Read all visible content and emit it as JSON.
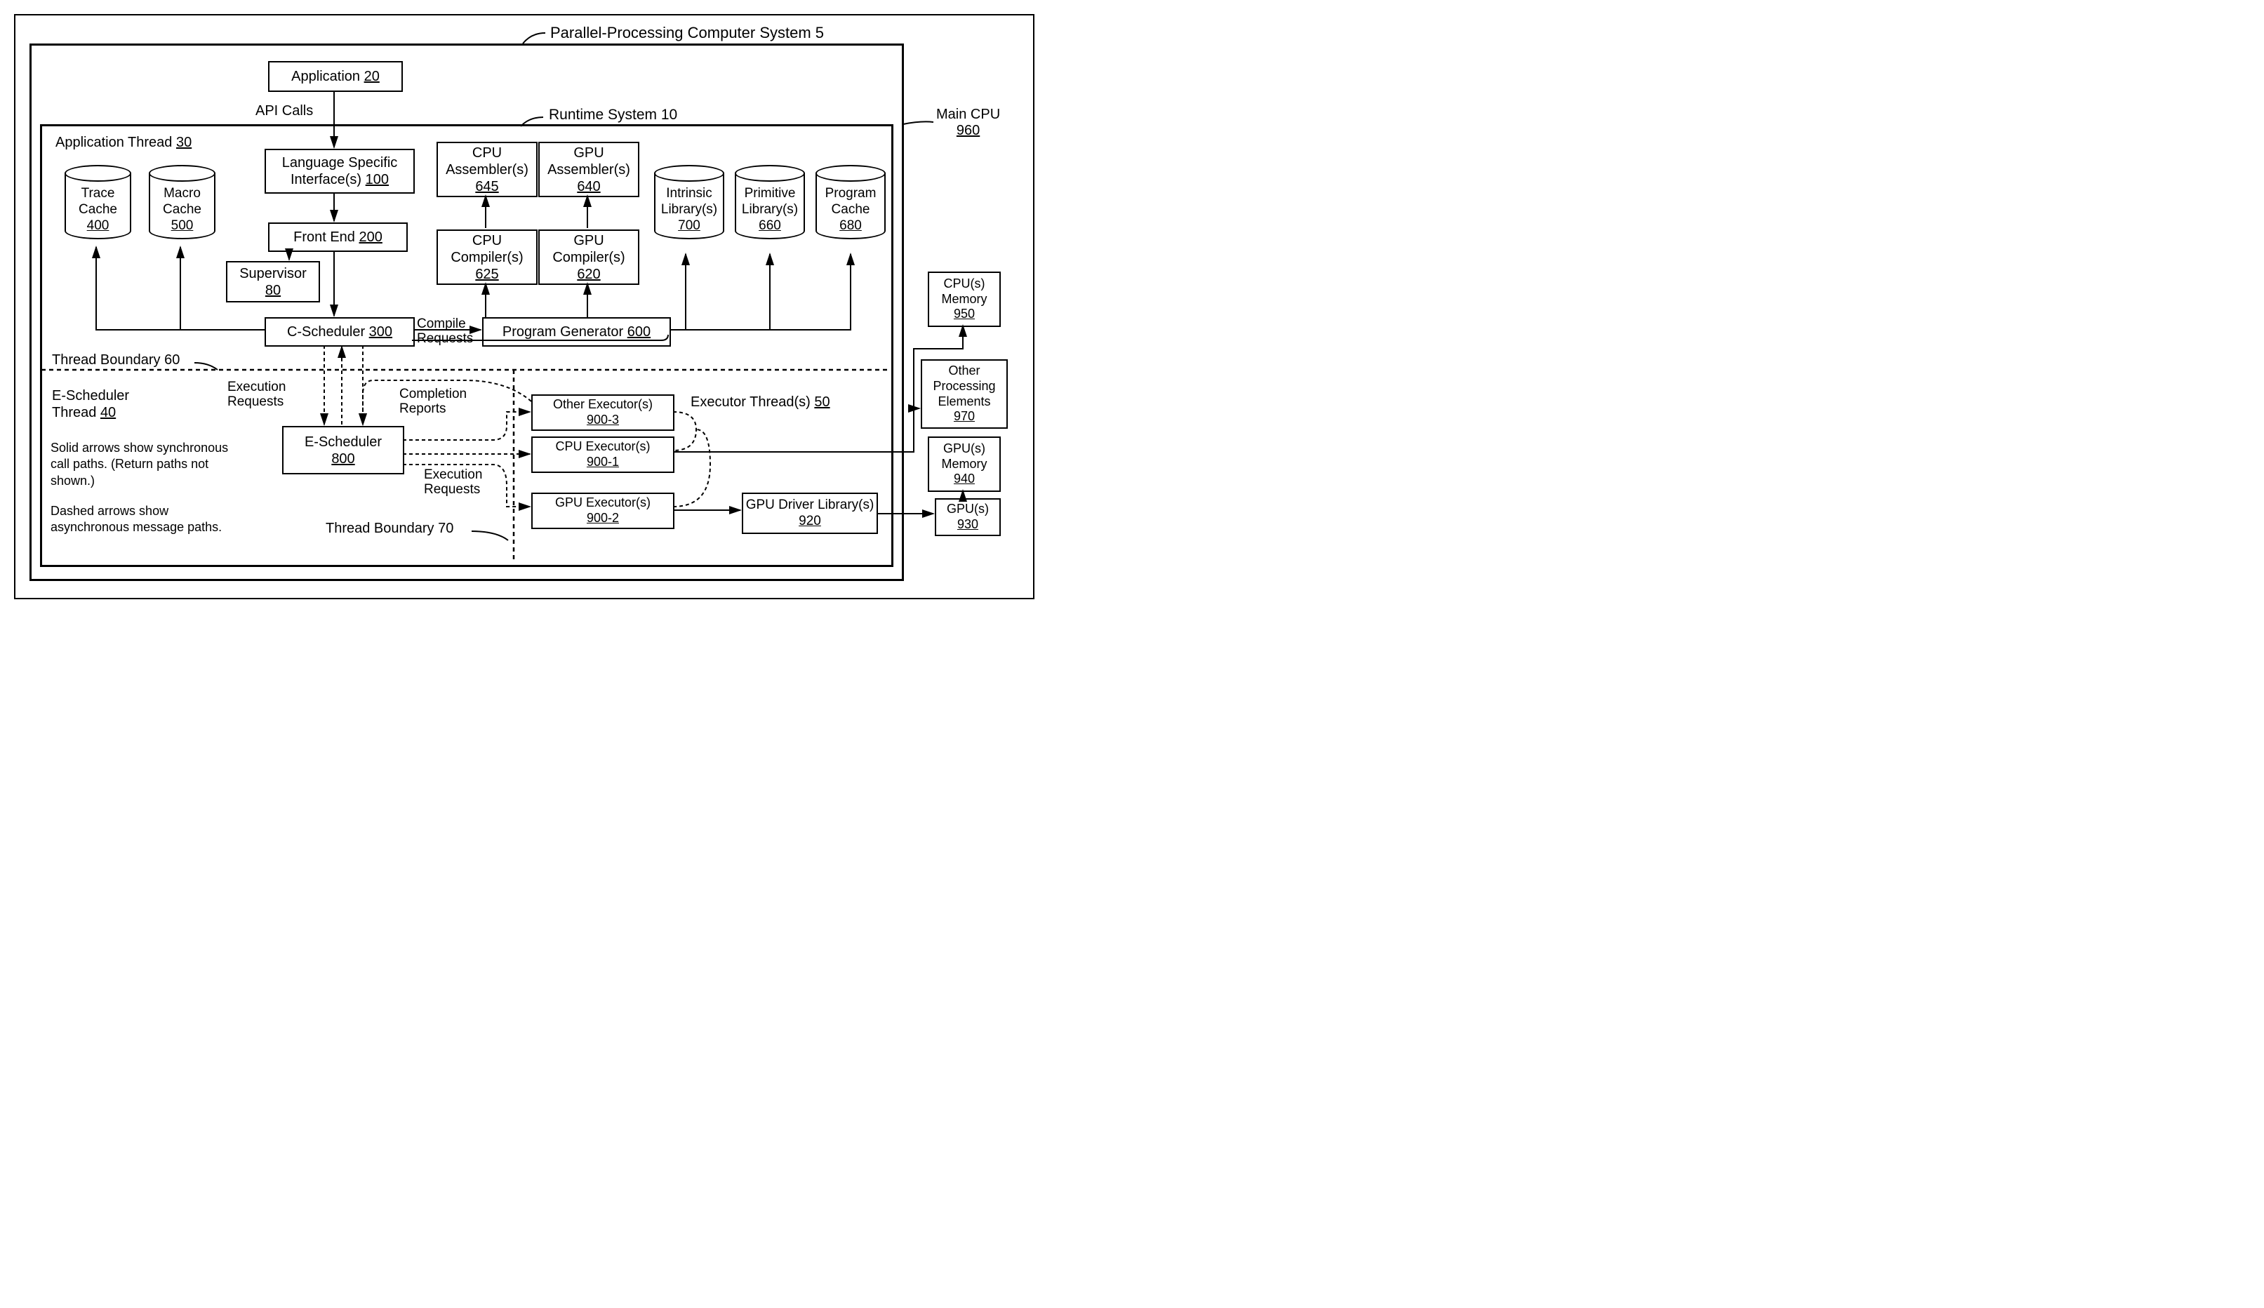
{
  "title": "Parallel-Processing Computer System 5",
  "main_cpu": {
    "label": "Main CPU",
    "num": "960"
  },
  "runtime": {
    "label": "Runtime System 10"
  },
  "app_thread": {
    "label": "Application Thread",
    "num": "30"
  },
  "application": {
    "label": "Application",
    "num": "20"
  },
  "api_calls": "API Calls",
  "lang_spec": {
    "label": "Language Specific Interface(s)",
    "num": "100"
  },
  "front_end": {
    "label": "Front End",
    "num": "200"
  },
  "supervisor": {
    "label": "Supervisor",
    "num": "80"
  },
  "c_scheduler": {
    "label": "C-Scheduler",
    "num": "300"
  },
  "compile_requests": "Compile Requests",
  "cpu_asm": {
    "label": "CPU Assembler(s)",
    "num": "645"
  },
  "gpu_asm": {
    "label": "GPU Assembler(s)",
    "num": "640"
  },
  "cpu_comp": {
    "label": "CPU Compiler(s)",
    "num": "625"
  },
  "gpu_comp": {
    "label": "GPU Compiler(s)",
    "num": "620"
  },
  "prog_gen": {
    "label": "Program Generator",
    "num": "600"
  },
  "trace_cache": {
    "label": "Trace Cache",
    "num": "400"
  },
  "macro_cache": {
    "label": "Macro Cache",
    "num": "500"
  },
  "intrinsic_lib": {
    "label": "Intrinsic Library(s)",
    "num": "700"
  },
  "primitive_lib": {
    "label": "Primitive Library(s)",
    "num": "660"
  },
  "program_cache": {
    "label": "Program Cache",
    "num": "680"
  },
  "thread_boundary_60": "Thread Boundary 60",
  "thread_boundary_70": "Thread Boundary 70",
  "e_sched_thread": {
    "label": "E-Scheduler Thread",
    "num": "40"
  },
  "execution_requests": "Execution Requests",
  "completion_reports": "Completion Reports",
  "e_scheduler": {
    "label": "E-Scheduler",
    "num": "800"
  },
  "other_exec": {
    "label": "Other Executor(s)",
    "num": "900-3"
  },
  "cpu_exec": {
    "label": "CPU Executor(s)",
    "num": "900-1"
  },
  "gpu_exec": {
    "label": "GPU Executor(s)",
    "num": "900-2"
  },
  "executor_threads": {
    "label": "Executor Thread(s)",
    "num": "50"
  },
  "gpu_driver": {
    "label": "GPU Driver Library(s)",
    "num": "920"
  },
  "cpus_memory": {
    "label": "CPU(s) Memory",
    "num": "950"
  },
  "other_proc": {
    "label": "Other Processing Elements",
    "num": "970"
  },
  "gpus_memory": {
    "label": "GPU(s) Memory",
    "num": "940"
  },
  "gpus": {
    "label": "GPU(s)",
    "num": "930"
  },
  "note1": "Solid arrows show synchronous call paths.  (Return paths not shown.)",
  "note2": "Dashed arrows show asynchronous message paths."
}
